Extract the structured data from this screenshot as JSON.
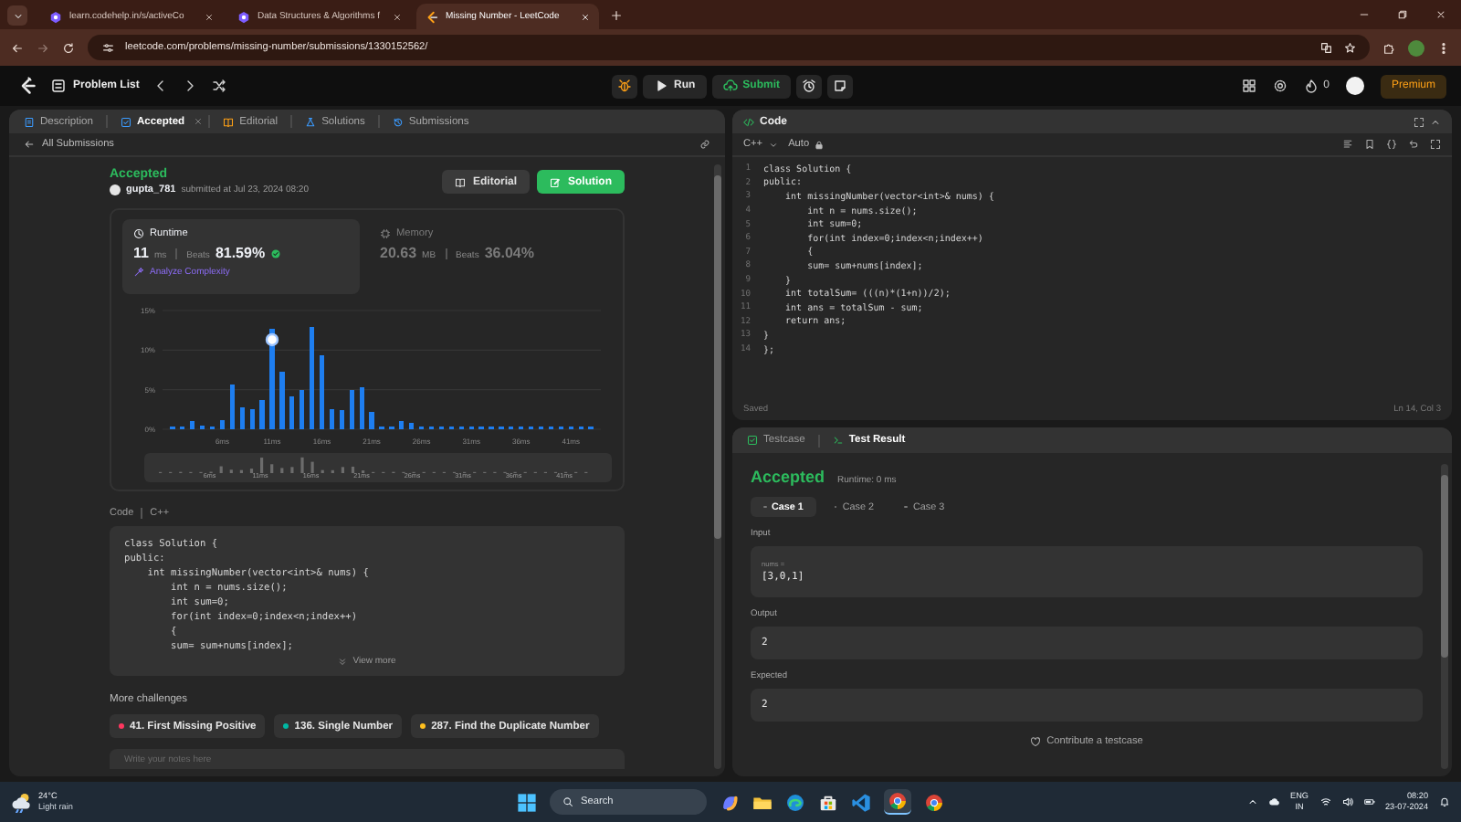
{
  "browser": {
    "tabs": [
      {
        "title": "learn.codehelp.in/s/activeCo",
        "selected": false
      },
      {
        "title": "Data Structures & Algorithms f",
        "selected": false
      },
      {
        "title": "Missing Number - LeetCode",
        "selected": true
      }
    ],
    "url": "leetcode.com/problems/missing-number/submissions/1330152562/"
  },
  "navbar": {
    "problem_list": "Problem List",
    "run": "Run",
    "submit": "Submit",
    "streak": "0",
    "premium": "Premium"
  },
  "left_panel": {
    "tabs": [
      {
        "label": "Description",
        "selected": false,
        "closable": false
      },
      {
        "label": "Accepted",
        "selected": true,
        "closable": true
      },
      {
        "label": "Editorial",
        "selected": false,
        "closable": false
      },
      {
        "label": "Solutions",
        "selected": false,
        "closable": false
      },
      {
        "label": "Submissions",
        "selected": false,
        "closable": false
      }
    ],
    "back_link": "All Submissions",
    "status": "Accepted",
    "user": "gupta_781",
    "submitted": "submitted at Jul 23, 2024 08:20",
    "buttons": [
      {
        "label": "Editorial",
        "kind": "secondary"
      },
      {
        "label": "Solution",
        "kind": "primary"
      }
    ],
    "stats": [
      {
        "title": "Runtime",
        "value": "11",
        "unit": "ms",
        "beats_label": "Beats",
        "beats": "81.59%",
        "link": "Analyze Complexity",
        "selected": true
      },
      {
        "title": "Memory",
        "value": "20.63",
        "unit": "MB",
        "beats_label": "Beats",
        "beats": "36.04%",
        "selected": false
      }
    ],
    "chart_data": {
      "type": "bar",
      "x": [
        1,
        2,
        3,
        4,
        5,
        6,
        7,
        8,
        9,
        10,
        11,
        12,
        13,
        14,
        15,
        16,
        17,
        18,
        19,
        20,
        21,
        22,
        23,
        24,
        25,
        26,
        27,
        28,
        29,
        30,
        31,
        32,
        33,
        34,
        35,
        36,
        37,
        38,
        39,
        40,
        41,
        42,
        43
      ],
      "xlim": [
        0,
        44
      ],
      "series": [
        {
          "color": "#1e7ef0",
          "values": [
            0.3,
            0.3,
            1.0,
            0.5,
            0.4,
            1.1,
            5.6,
            2.8,
            2.5,
            3.7,
            12.7,
            7.3,
            4.2,
            5.0,
            12.9,
            9.3,
            2.5,
            2.4,
            5.0,
            5.3,
            2.2,
            0.4,
            0.3,
            1.0,
            0.8,
            0.3,
            0.3,
            0.3,
            0.3,
            0.3,
            0.3,
            0.3,
            0.3,
            0.3,
            0.3,
            0.3,
            0.3,
            0.3,
            0.3,
            0.3,
            0.3,
            0.3,
            0.3
          ]
        }
      ],
      "ylim": [
        0,
        15
      ],
      "yticks": [
        {
          "value": 0,
          "label": "0%"
        },
        {
          "value": 5,
          "label": "5%"
        },
        {
          "value": 10,
          "label": "10%"
        },
        {
          "value": 15,
          "label": "15%"
        }
      ],
      "xticks": [
        {
          "value": 6,
          "label": "6ms"
        },
        {
          "value": 11,
          "label": "11ms"
        },
        {
          "value": 16,
          "label": "16ms"
        },
        {
          "value": 21,
          "label": "21ms"
        },
        {
          "value": 26,
          "label": "26ms"
        },
        {
          "value": 31,
          "label": "31ms"
        },
        {
          "value": 36,
          "label": "36ms"
        },
        {
          "value": 41,
          "label": "41ms"
        }
      ]
    },
    "overview_labels": [
      "6ms",
      "11ms",
      "16ms",
      "21ms",
      "26ms",
      "31ms",
      "36ms",
      "41ms"
    ],
    "code_label": "Code",
    "code_language": "C++",
    "code_lines": [
      "class Solution {",
      "public:",
      "    int missingNumber(vector<int>& nums) {",
      "        int n = nums.size();",
      "        int sum=0;",
      "        for(int index=0;index<n;index++)",
      "        {",
      "        sum= sum+nums[index];"
    ],
    "view_more": "View more",
    "more_title": "More challenges",
    "challenges": [
      {
        "title": "41. First Missing Positive",
        "color": "#ff375f"
      },
      {
        "title": "136. Single Number",
        "color": "#00b8a3"
      },
      {
        "title": "287. Find the Duplicate Number",
        "color": "#ffc01e"
      }
    ],
    "notes": {
      "placeholder": "Write your notes here"
    }
  },
  "editor": {
    "title": "Code",
    "language": "C++",
    "mode": "Auto",
    "lines": [
      {
        "number": "1",
        "text": "class Solution {"
      },
      {
        "number": "2",
        "text": "public:"
      },
      {
        "number": "3",
        "text": "    int missingNumber(vector<int>& nums) {"
      },
      {
        "number": "4",
        "text": "        int n = nums.size();"
      },
      {
        "number": "5",
        "text": "        int sum=0;"
      },
      {
        "number": "6",
        "text": "        for(int index=0;index<n;index++)"
      },
      {
        "number": "7",
        "text": "        {"
      },
      {
        "number": "8",
        "text": "        sum= sum+nums[index];"
      },
      {
        "number": "9",
        "text": "    }"
      },
      {
        "number": "10",
        "text": "    int totalSum= (((n)*(1+n))/2);"
      },
      {
        "number": "11",
        "text": "    int ans = totalSum - sum;"
      },
      {
        "number": "12",
        "text": "    return ans;"
      },
      {
        "number": "13",
        "text": "}"
      },
      {
        "number": "14",
        "text": "};"
      }
    ],
    "status": "Saved",
    "cursor": "Ln 14, Col 3"
  },
  "results": {
    "tabs": [
      {
        "label": "Testcase",
        "selected": false
      },
      {
        "label": "Test Result",
        "selected": true
      }
    ],
    "status": "Accepted",
    "runtime": "Runtime: 0 ms",
    "cases": [
      {
        "label": "Case 1",
        "selected": true
      },
      {
        "label": "Case 2",
        "selected": false
      },
      {
        "label": "Case 3",
        "selected": false
      }
    ],
    "input_label": "Input",
    "input_name": "nums =",
    "input_value": "[3,0,1]",
    "output_label": "Output",
    "output_value": "2",
    "expected_label": "Expected",
    "expected_value": "2",
    "contribute": "Contribute a testcase"
  },
  "taskbar": {
    "temperature": "24°C",
    "weather": "Light rain",
    "search": "Search",
    "language": "ENG",
    "region": "IN",
    "time": "08:20",
    "date": "23-07-2024"
  }
}
